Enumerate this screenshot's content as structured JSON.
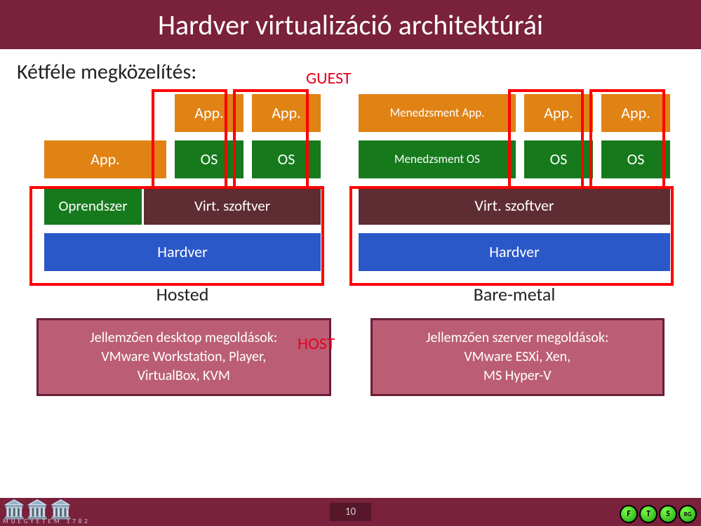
{
  "title": "Hardver virtualizáció architektúrái",
  "subtitle": "Kétféle megközelítés:",
  "annotations": {
    "guest": "GUEST",
    "host": "HOST"
  },
  "left": {
    "label": "Hosted",
    "topApps": [
      "App.",
      "App."
    ],
    "hostApp": "App.",
    "guestOS": [
      "OS",
      "OS"
    ],
    "hostOS": "Oprendszer",
    "virt": "Virt. szoftver",
    "hardware": "Hardver",
    "example": {
      "line1": "Jellemzően desktop megoldások:",
      "line2": "VMware Workstation, Player,",
      "line3": "VirtualBox, KVM"
    }
  },
  "right": {
    "label": "Bare-metal",
    "mgmtApp": "Menedzsment App.",
    "topApps": [
      "App.",
      "App."
    ],
    "mgmtOS": "Menedzsment OS",
    "guestOS": [
      "OS",
      "OS"
    ],
    "virt": "Virt. szoftver",
    "hardware": "Hardver",
    "example": {
      "line1": "Jellemzően szerver megoldások:",
      "line2": "VMware ESXi, Xen,",
      "line3": "MS Hyper-V"
    }
  },
  "footer": {
    "page": "10",
    "leftCaption": "MŰEGYETEM 1782",
    "rightDots": [
      "F",
      "T",
      "S",
      "RG"
    ]
  }
}
